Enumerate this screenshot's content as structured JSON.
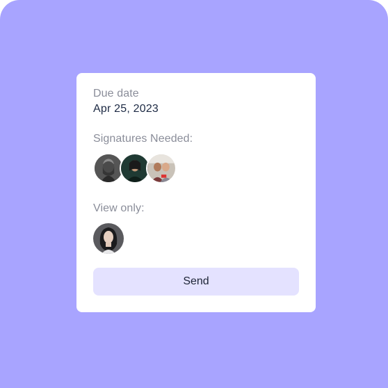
{
  "card": {
    "due_date_label": "Due date",
    "due_date_value": "Apr 25, 2023",
    "signatures_label": "Signatures Needed:",
    "signers": [
      {
        "avatar": "avatar-photo-man-beard"
      },
      {
        "avatar": "avatar-photo-woman-dark"
      },
      {
        "avatar": "avatar-photo-group"
      }
    ],
    "view_only_label": "View only:",
    "viewers": [
      {
        "avatar": "avatar-photo-woman-curly"
      }
    ],
    "send_label": "Send"
  },
  "colors": {
    "background": "#a8a4ff",
    "card": "#ffffff",
    "button": "#e4e2ff",
    "label": "#8a8d99",
    "value": "#1d2a44"
  }
}
